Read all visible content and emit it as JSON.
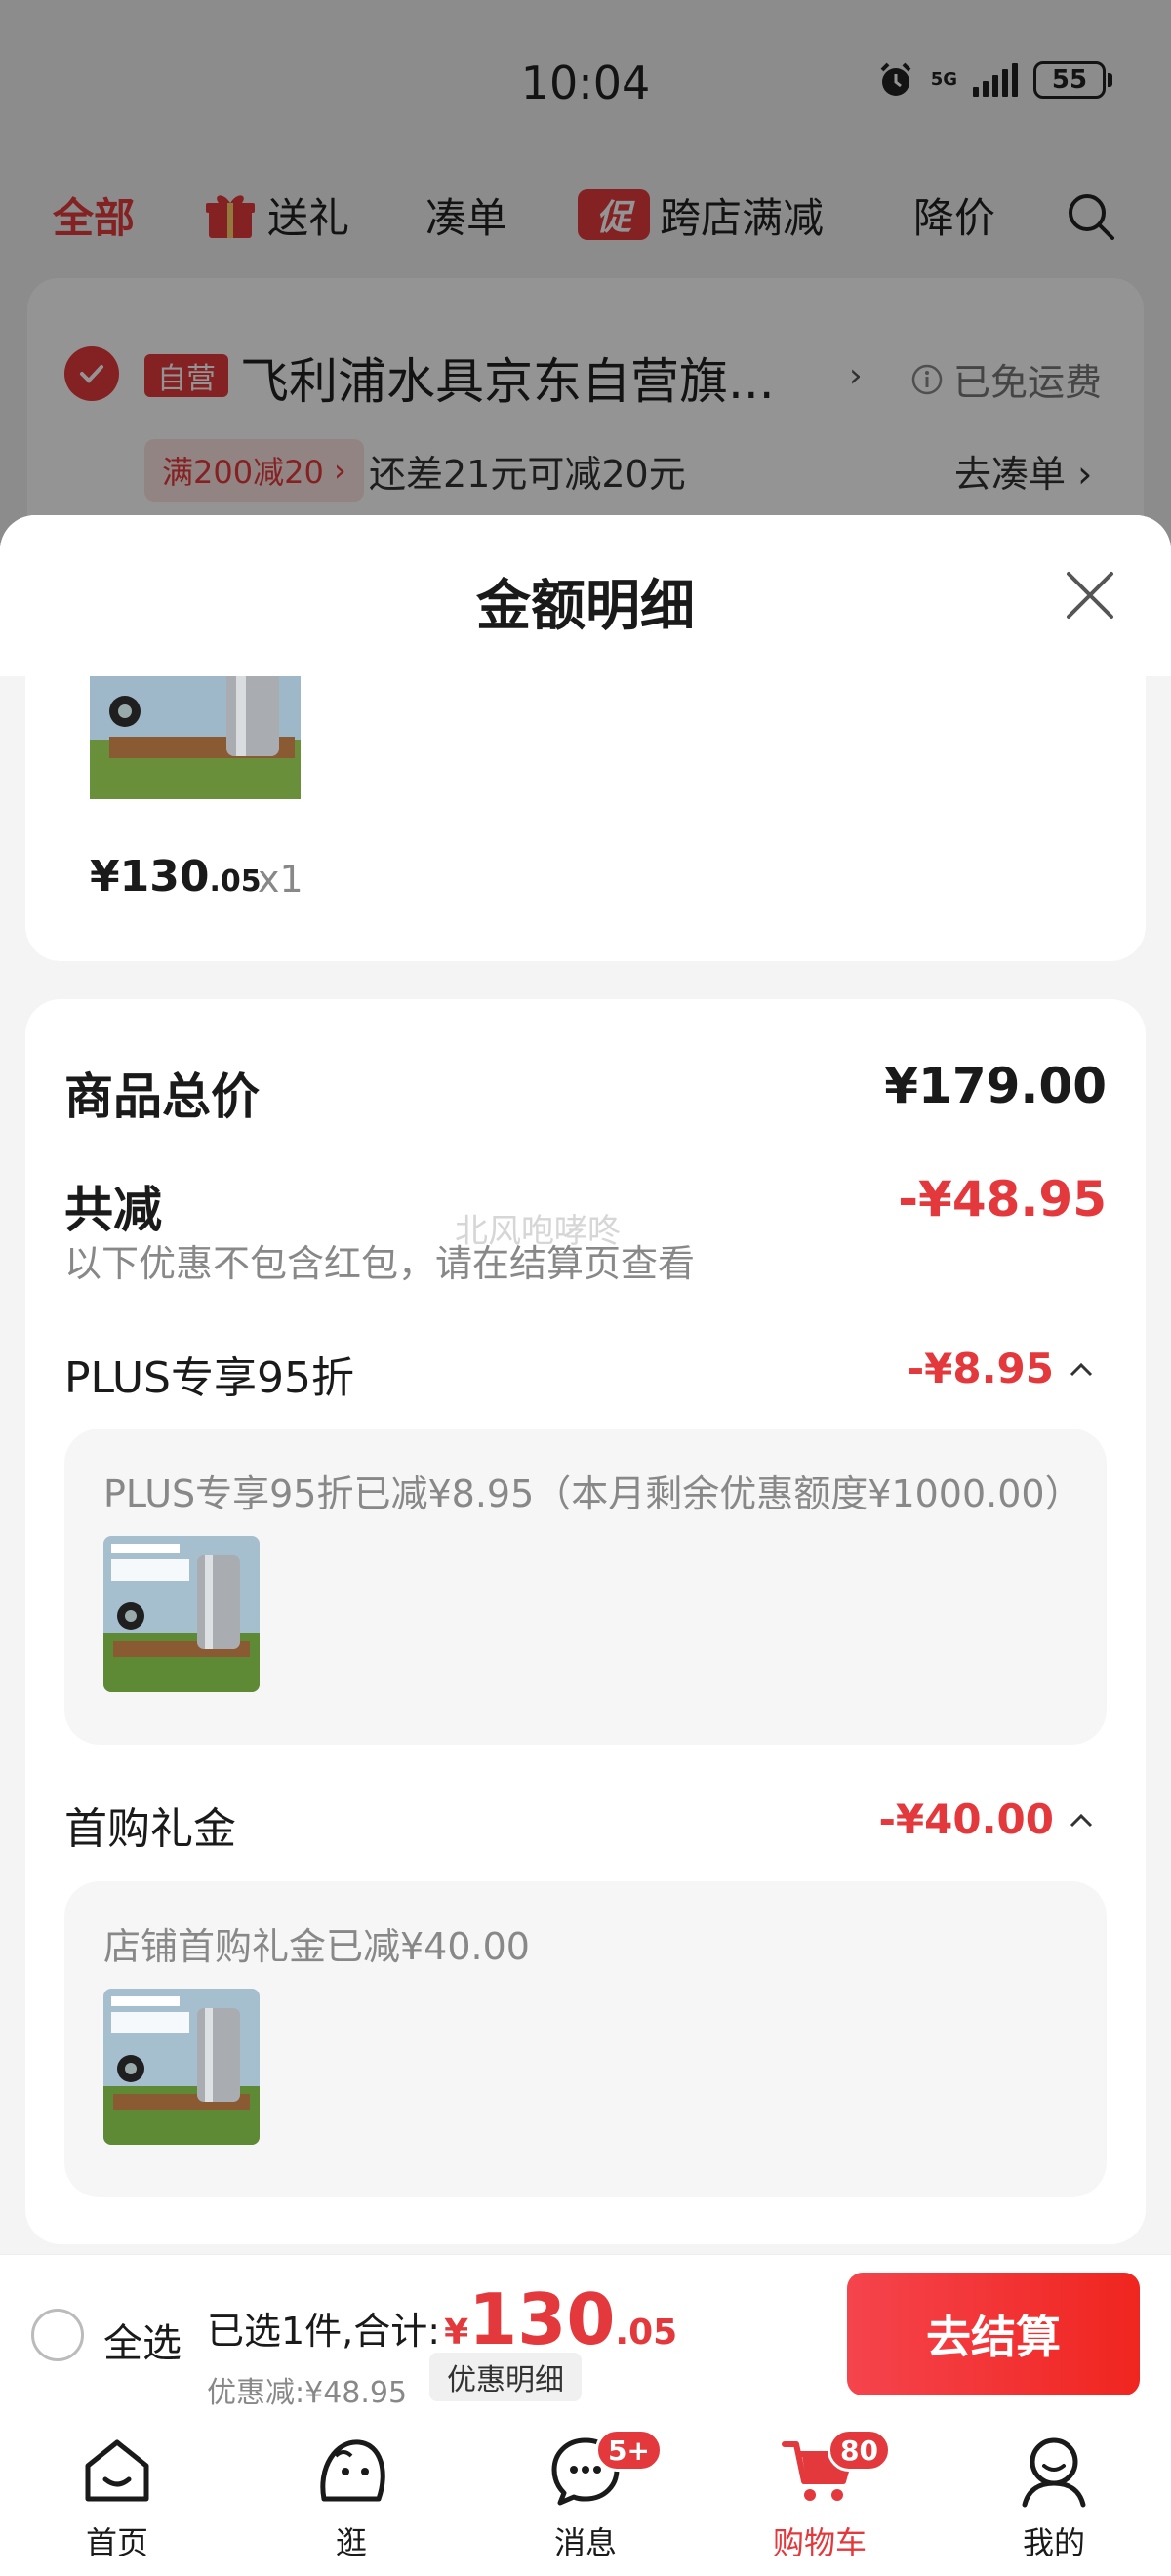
{
  "status_bar": {
    "time": "10:04",
    "network": "5G",
    "battery": "55"
  },
  "tabs": [
    {
      "label": "全部",
      "active": true
    },
    {
      "label": "送礼",
      "icon": "gift-icon"
    },
    {
      "label": "凑单"
    },
    {
      "label": "跨店满减",
      "badge": "促"
    },
    {
      "label": "降价"
    }
  ],
  "store": {
    "self_run_badge": "自营",
    "name": "飞利浦水具京东自营旗...",
    "shipping": "已免运费",
    "promo_tag": "满200减20",
    "promo_hint": "还差21元可减20元",
    "go_add": "去凑单"
  },
  "sheet": {
    "title": "金额明细",
    "product": {
      "price_int": "¥130",
      "price_dec": ".05",
      "quantity": "x1"
    },
    "total_label": "商品总价",
    "total_value": "¥179.00",
    "reduce_label": "共减",
    "reduce_value": "-¥48.95",
    "reduce_note": "以下优惠不包含红包，请在结算页查看",
    "watermark": "北风咆哮咚",
    "items": [
      {
        "label": "PLUS专享95折",
        "amount": "-¥8.95",
        "detail": "PLUS专享95折已减¥8.95（本月剩余优惠额度¥1000.00）"
      },
      {
        "label": "首购礼金",
        "amount": "-¥40.00",
        "detail": "店铺首购礼金已减¥40.00"
      }
    ]
  },
  "action_bar": {
    "select_all": "全选",
    "selected_text": "已选1件,合计:",
    "yen": "¥",
    "total_int": "130",
    "total_dec": ".05",
    "discount_text": "优惠减:¥48.95",
    "discount_detail_btn": "优惠明细",
    "checkout": "去结算"
  },
  "bottom_nav": [
    {
      "label": "首页",
      "icon": "home-icon"
    },
    {
      "label": "逛",
      "icon": "stroll-icon"
    },
    {
      "label": "消息",
      "icon": "message-icon",
      "badge": "5+"
    },
    {
      "label": "购物车",
      "icon": "cart-icon",
      "badge": "80",
      "active": true
    },
    {
      "label": "我的",
      "icon": "profile-icon"
    }
  ],
  "colors": {
    "accent": "#e4393c",
    "muted": "#888888"
  }
}
